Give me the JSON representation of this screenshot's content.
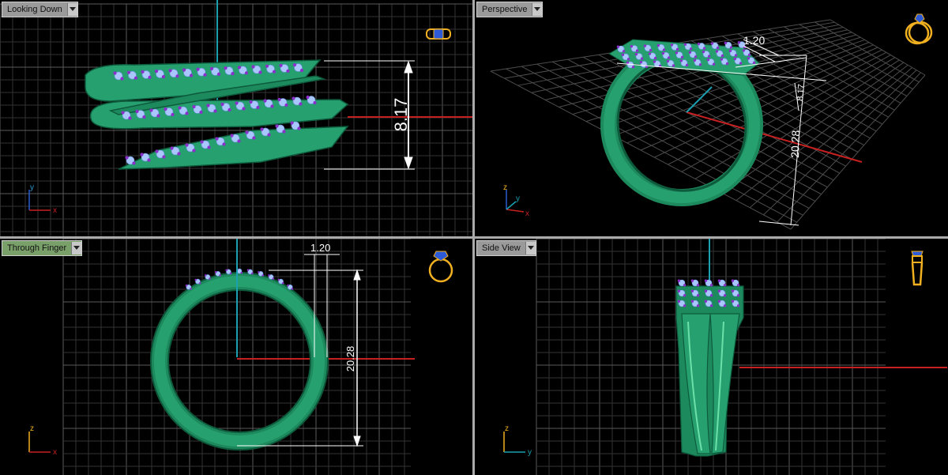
{
  "viewports": {
    "top_left": {
      "title": "Looking Down",
      "dimensions": {
        "height": "8.17"
      },
      "axes": {
        "vertical": "y",
        "horizontal": "x"
      }
    },
    "top_right": {
      "title": "Perspective",
      "dimensions": {
        "width": "1.20",
        "small": "8.17",
        "height": "20.28"
      },
      "axes": {
        "z": "z",
        "y": "y",
        "x": "x"
      }
    },
    "bottom_left": {
      "title": "Through Finger",
      "dimensions": {
        "width": "1.20",
        "height": "20.28"
      },
      "axes": {
        "vertical": "z",
        "horizontal": "x"
      }
    },
    "bottom_right": {
      "title": "Side View",
      "axes": {
        "vertical": "z",
        "horizontal": "y"
      }
    }
  },
  "colors": {
    "metal": "#27a070",
    "metal_dark": "#0d5a3c",
    "stone_light": "#a9c7ff",
    "prong": "#8a2fc9",
    "grid": "#3b3b3b",
    "grid_major": "#5a5a5a",
    "axis_x": "#c62020",
    "axis_y": "#1aa0b0",
    "icon": "#f0b020",
    "gem_icon": "#2d5bd8"
  },
  "icons": [
    "ring-top-icon",
    "ring-perspective-icon",
    "ring-front-icon",
    "ring-side-icon",
    "viewport-menu-icon"
  ]
}
